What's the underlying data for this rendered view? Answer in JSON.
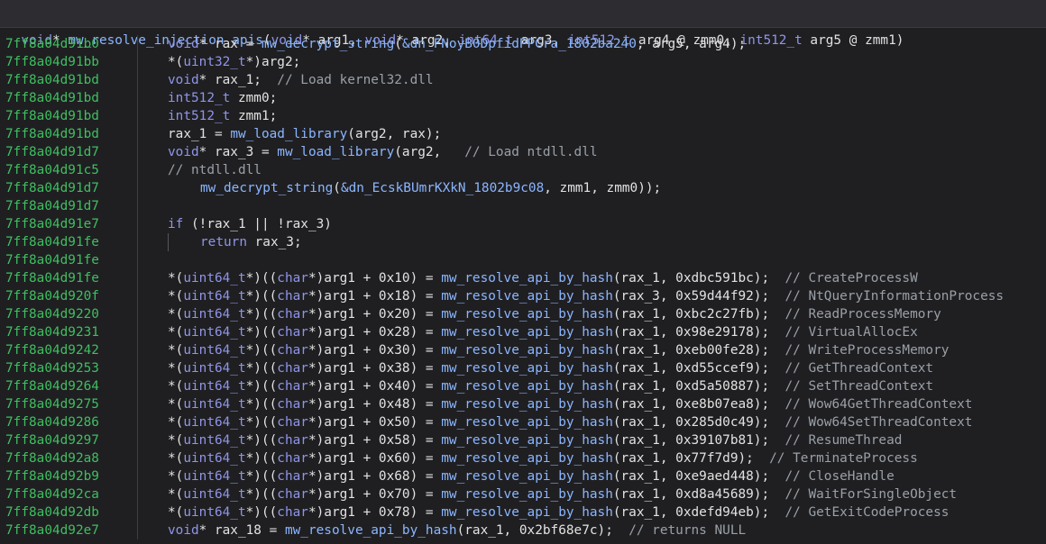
{
  "header": {
    "signature": "void* mw_resolve_injection_apis(void* arg1, void* arg2, int64_t arg3, int512_t arg4 @ zmm0, int512_t arg5 @ zmm1)"
  },
  "lines": [
    {
      "addr": "7ff8a04d91b0",
      "code": "void* rax = mw_decrypt_string(&dn_FNoyB0DpfidPPGra_1802ba240, arg5, arg4);",
      "indent": 1
    },
    {
      "addr": "7ff8a04d91bb",
      "code": "*(uint32_t*)arg2;",
      "indent": 1
    },
    {
      "addr": "7ff8a04d91bd",
      "code": "void* rax_1;  // Load kernel32.dll",
      "indent": 1
    },
    {
      "addr": "7ff8a04d91bd",
      "code": "int512_t zmm0;",
      "indent": 1
    },
    {
      "addr": "7ff8a04d91bd",
      "code": "int512_t zmm1;",
      "indent": 1
    },
    {
      "addr": "7ff8a04d91bd",
      "code": "rax_1 = mw_load_library(arg2, rax);",
      "indent": 1
    },
    {
      "addr": "7ff8a04d91d7",
      "code": "void* rax_3 = mw_load_library(arg2,   // Load ntdll.dll",
      "indent": 1
    },
    {
      "addr": "7ff8a04d91c5",
      "code": "// ntdll.dll",
      "indent": 1
    },
    {
      "addr": "7ff8a04d91d7",
      "code": "mw_decrypt_string(&dn_EcskBUmrKXkN_1802b9c08, zmm1, zmm0));",
      "indent": 2
    },
    {
      "addr": "7ff8a04d91d7",
      "code": "",
      "indent": 1
    },
    {
      "addr": "7ff8a04d91e7",
      "code": "if (!rax_1 || !rax_3)",
      "indent": 1
    },
    {
      "addr": "7ff8a04d91fe",
      "code": "return rax_3;",
      "indent": 2,
      "bar": true
    },
    {
      "addr": "7ff8a04d91fe",
      "code": "",
      "indent": 1
    },
    {
      "addr": "7ff8a04d91fe",
      "code": "*(uint64_t*)((char*)arg1 + 0x10) = mw_resolve_api_by_hash(rax_1, 0xdbc591bc);  // CreateProcessW",
      "indent": 1
    },
    {
      "addr": "7ff8a04d920f",
      "code": "*(uint64_t*)((char*)arg1 + 0x18) = mw_resolve_api_by_hash(rax_3, 0x59d44f92);  // NtQueryInformationProcess",
      "indent": 1
    },
    {
      "addr": "7ff8a04d9220",
      "code": "*(uint64_t*)((char*)arg1 + 0x20) = mw_resolve_api_by_hash(rax_1, 0xbc2c27fb);  // ReadProcessMemory",
      "indent": 1
    },
    {
      "addr": "7ff8a04d9231",
      "code": "*(uint64_t*)((char*)arg1 + 0x28) = mw_resolve_api_by_hash(rax_1, 0x98e29178);  // VirtualAllocEx",
      "indent": 1
    },
    {
      "addr": "7ff8a04d9242",
      "code": "*(uint64_t*)((char*)arg1 + 0x30) = mw_resolve_api_by_hash(rax_1, 0xeb00fe28);  // WriteProcessMemory",
      "indent": 1
    },
    {
      "addr": "7ff8a04d9253",
      "code": "*(uint64_t*)((char*)arg1 + 0x38) = mw_resolve_api_by_hash(rax_1, 0xd55ccef9);  // GetThreadContext",
      "indent": 1
    },
    {
      "addr": "7ff8a04d9264",
      "code": "*(uint64_t*)((char*)arg1 + 0x40) = mw_resolve_api_by_hash(rax_1, 0xd5a50887);  // SetThreadContext",
      "indent": 1
    },
    {
      "addr": "7ff8a04d9275",
      "code": "*(uint64_t*)((char*)arg1 + 0x48) = mw_resolve_api_by_hash(rax_1, 0xe8b07ea8);  // Wow64GetThreadContext",
      "indent": 1
    },
    {
      "addr": "7ff8a04d9286",
      "code": "*(uint64_t*)((char*)arg1 + 0x50) = mw_resolve_api_by_hash(rax_1, 0x285d0c49);  // Wow64SetThreadContext",
      "indent": 1
    },
    {
      "addr": "7ff8a04d9297",
      "code": "*(uint64_t*)((char*)arg1 + 0x58) = mw_resolve_api_by_hash(rax_1, 0x39107b81);  // ResumeThread",
      "indent": 1
    },
    {
      "addr": "7ff8a04d92a8",
      "code": "*(uint64_t*)((char*)arg1 + 0x60) = mw_resolve_api_by_hash(rax_1, 0x77f7d9);  // TerminateProcess",
      "indent": 1
    },
    {
      "addr": "7ff8a04d92b9",
      "code": "*(uint64_t*)((char*)arg1 + 0x68) = mw_resolve_api_by_hash(rax_1, 0xe9aed448);  // CloseHandle",
      "indent": 1
    },
    {
      "addr": "7ff8a04d92ca",
      "code": "*(uint64_t*)((char*)arg1 + 0x70) = mw_resolve_api_by_hash(rax_1, 0xd8a45689);  // WaitForSingleObject",
      "indent": 1
    },
    {
      "addr": "7ff8a04d92db",
      "code": "*(uint64_t*)((char*)arg1 + 0x78) = mw_resolve_api_by_hash(rax_1, 0xdefd94eb);  // GetExitCodeProcess",
      "indent": 1
    },
    {
      "addr": "7ff8a04d92e7",
      "code": "void* rax_18 = mw_resolve_api_by_hash(rax_1, 0x2bf68e7c);  // returns NULL",
      "indent": 1
    }
  ],
  "colors": {
    "background": "#1f1f22",
    "header_bg": "#2d2d31",
    "address": "#3fbf5f",
    "keyword": "#8f95e8",
    "function": "#8bb6ff",
    "comment": "#9aa0a6",
    "text": "#e2e2e2"
  }
}
